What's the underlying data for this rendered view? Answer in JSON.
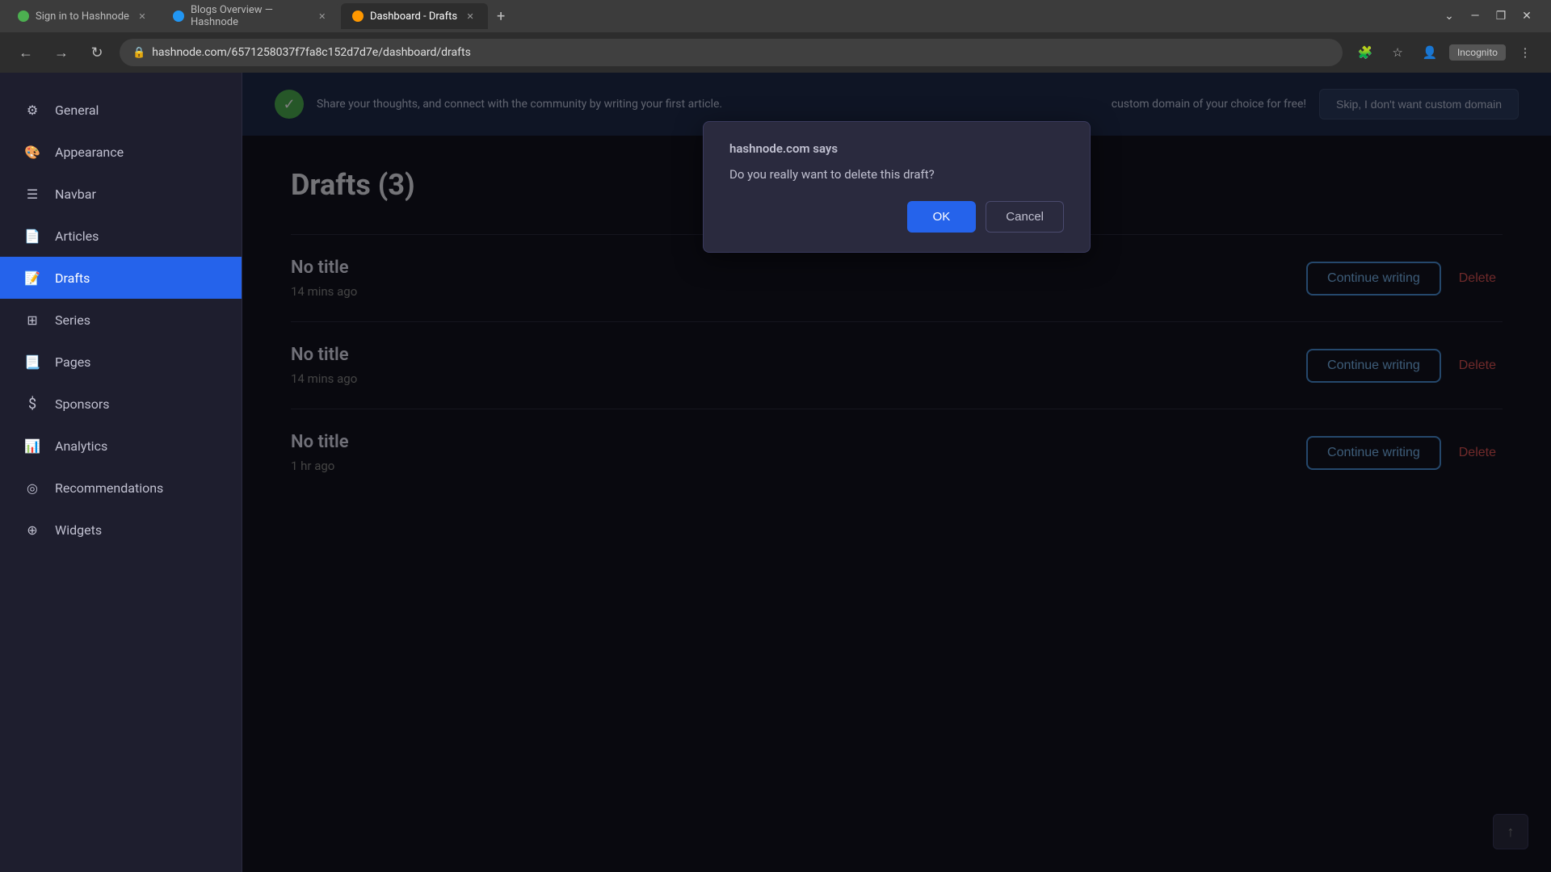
{
  "browser": {
    "tabs": [
      {
        "id": "tab1",
        "label": "Sign in to Hashnode",
        "favicon_color": "green",
        "active": false
      },
      {
        "id": "tab2",
        "label": "Blogs Overview — Hashnode",
        "favicon_color": "blue",
        "active": false
      },
      {
        "id": "tab3",
        "label": "Dashboard - Drafts",
        "favicon_color": "orange",
        "active": true
      }
    ],
    "url": "hashnode.com/6571258037f7fa8c152d7d7e/dashboard/drafts",
    "incognito_label": "Incognito"
  },
  "banner": {
    "text": "Share your thoughts, and connect with the community by writing your first article.",
    "skip_label": "Skip, I don't want custom domain",
    "custom_domain_text": "custom domain of your choice for free!"
  },
  "sidebar": {
    "items": [
      {
        "id": "general",
        "label": "General",
        "icon": "⚙"
      },
      {
        "id": "appearance",
        "label": "Appearance",
        "icon": "🎨"
      },
      {
        "id": "navbar",
        "label": "Navbar",
        "icon": "☰"
      },
      {
        "id": "articles",
        "label": "Articles",
        "icon": "📄"
      },
      {
        "id": "drafts",
        "label": "Drafts",
        "icon": "📝",
        "active": true
      },
      {
        "id": "series",
        "label": "Series",
        "icon": "⊞"
      },
      {
        "id": "pages",
        "label": "Pages",
        "icon": "📃"
      },
      {
        "id": "sponsors",
        "label": "Sponsors",
        "icon": "$"
      },
      {
        "id": "analytics",
        "label": "Analytics",
        "icon": "📊"
      },
      {
        "id": "recommendations",
        "label": "Recommendations",
        "icon": "◎"
      },
      {
        "id": "widgets",
        "label": "Widgets",
        "icon": "⊕"
      }
    ]
  },
  "page": {
    "title": "Drafts (3)",
    "drafts": [
      {
        "id": "draft1",
        "name": "No title",
        "time": "14 mins ago",
        "continue_label": "Continue writing",
        "delete_label": "Delete",
        "delete_prominent": true
      },
      {
        "id": "draft2",
        "name": "No title",
        "time": "14 mins ago",
        "continue_label": "Continue writing",
        "delete_label": "Delete",
        "delete_prominent": false
      },
      {
        "id": "draft3",
        "name": "No title",
        "time": "1 hr ago",
        "continue_label": "Continue writing",
        "delete_label": "Delete",
        "delete_prominent": false
      }
    ]
  },
  "dialog": {
    "site": "hashnode.com says",
    "message": "Do you really want to delete this draft?",
    "ok_label": "OK",
    "cancel_label": "Cancel"
  },
  "icons": {
    "back": "←",
    "forward": "→",
    "refresh": "↻",
    "lock": "🔒",
    "star": "☆",
    "menu": "⋮",
    "extensions": "🧩",
    "profile": "👤",
    "minimize": "—",
    "maximize": "❐",
    "close": "✕",
    "check": "✓",
    "scroll_top": "↑",
    "dropdown": "⋮"
  }
}
